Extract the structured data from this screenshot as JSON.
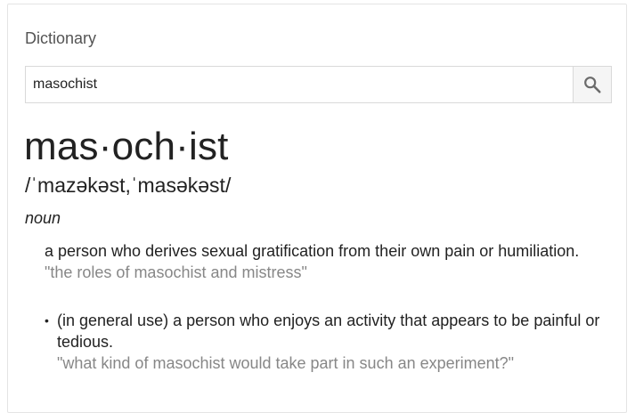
{
  "card": {
    "title": "Dictionary"
  },
  "search": {
    "value": "masochist",
    "icon": "search-icon"
  },
  "entry": {
    "headword": "mas·och·ist",
    "phonetic": "/ˈmazəkəst,ˈmasəkəst/",
    "part_of_speech": "noun",
    "definition": "a person who derives sexual gratification from their own pain or humiliation.",
    "example": "\"the roles of masochist and mistress\"",
    "subsense": {
      "bullet": "•",
      "definition": "(in general use) a person who enjoys an activity that appears to be painful or tedious.",
      "example": "\"what kind of masochist would take part in such an experiment?\""
    }
  }
}
